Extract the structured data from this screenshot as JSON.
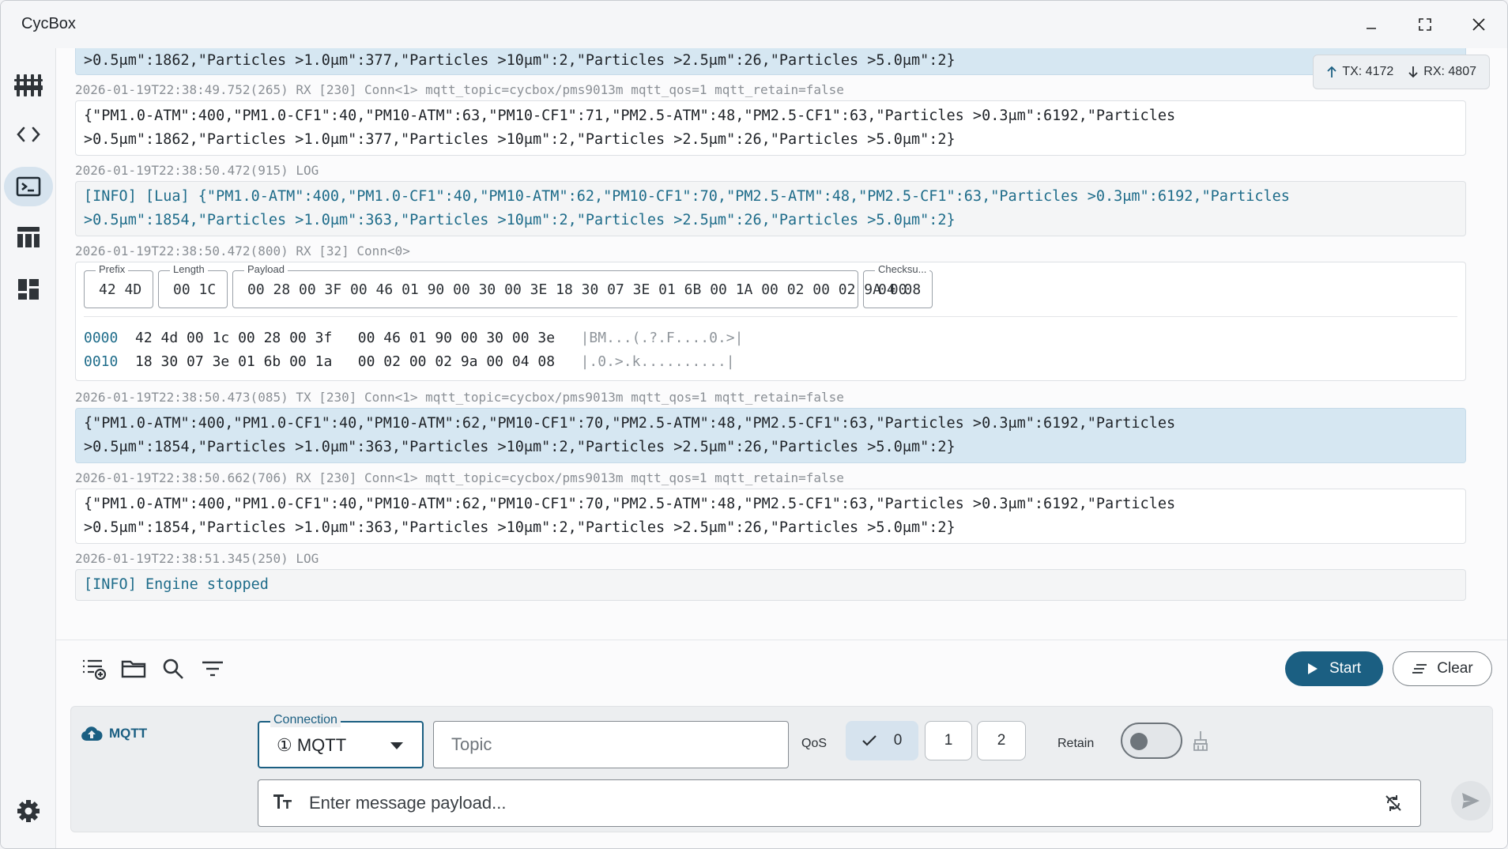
{
  "window": {
    "title": "CycBox"
  },
  "sidebar": {
    "items": [
      {
        "icon": "sliders-icon"
      },
      {
        "icon": "code-icon"
      },
      {
        "icon": "terminal-icon",
        "active": true
      },
      {
        "icon": "table-icon"
      },
      {
        "icon": "dashboard-icon"
      }
    ],
    "settings_icon": "gear-icon"
  },
  "stats": {
    "tx": "TX: 4172",
    "rx": "RX: 4807"
  },
  "log": {
    "top_partial": ">0.5μm\":1862,\"Particles >1.0μm\":377,\"Particles >10μm\":2,\"Particles >2.5μm\":26,\"Particles >5.0μm\":2}",
    "entry1": {
      "meta": "2026-01-19T22:38:49.752(265) RX [230] Conn<1> mqtt_topic=cycbox/pms9013m mqtt_qos=1 mqtt_retain=false",
      "line1": "{\"PM1.0-ATM\":400,\"PM1.0-CF1\":40,\"PM10-ATM\":63,\"PM10-CF1\":71,\"PM2.5-ATM\":48,\"PM2.5-CF1\":63,\"Particles >0.3μm\":6192,\"Particles",
      "line2": ">0.5μm\":1862,\"Particles >1.0μm\":377,\"Particles >10μm\":2,\"Particles >2.5μm\":26,\"Particles >5.0μm\":2}"
    },
    "entry2": {
      "meta": "2026-01-19T22:38:50.472(915) LOG",
      "line1": "[INFO] [Lua] {\"PM1.0-ATM\":400,\"PM1.0-CF1\":40,\"PM10-ATM\":62,\"PM10-CF1\":70,\"PM2.5-ATM\":48,\"PM2.5-CF1\":63,\"Particles >0.3μm\":6192,\"Particles",
      "line2": ">0.5μm\":1854,\"Particles >1.0μm\":363,\"Particles >10μm\":2,\"Particles >2.5μm\":26,\"Particles >5.0μm\":2}"
    },
    "entry3": {
      "meta": "2026-01-19T22:38:50.472(800) RX [32] Conn<0>",
      "fields": {
        "prefix_label": "Prefix",
        "prefix_value": "42 4D",
        "length_label": "Length",
        "length_value": "00 1C",
        "payload_label": "Payload",
        "payload_value": "00 28 00 3F 00 46 01 90 00 30 00 3E 18 30 07 3E 01 6B 00 1A 00 02 00 02 9A 00",
        "checksum_label": "Checksu...",
        "checksum_value": "04 08"
      },
      "hexdump": [
        {
          "offset": "0000",
          "bytes": "  42 4d 00 1c 00 28 00 3f   00 46 01 90 00 30 00 3e   ",
          "ascii": "|BM...(.?.F....0.>|"
        },
        {
          "offset": "0010",
          "bytes": "  18 30 07 3e 01 6b 00 1a   00 02 00 02 9a 00 04 08   ",
          "ascii": "|.0.>.k..........|"
        }
      ]
    },
    "entry4": {
      "meta": "2026-01-19T22:38:50.473(085) TX [230] Conn<1> mqtt_topic=cycbox/pms9013m mqtt_qos=1 mqtt_retain=false",
      "line1": "{\"PM1.0-ATM\":400,\"PM1.0-CF1\":40,\"PM10-ATM\":62,\"PM10-CF1\":70,\"PM2.5-ATM\":48,\"PM2.5-CF1\":63,\"Particles >0.3μm\":6192,\"Particles",
      "line2": ">0.5μm\":1854,\"Particles >1.0μm\":363,\"Particles >10μm\":2,\"Particles >2.5μm\":26,\"Particles >5.0μm\":2}"
    },
    "entry5": {
      "meta": "2026-01-19T22:38:50.662(706) RX [230] Conn<1> mqtt_topic=cycbox/pms9013m mqtt_qos=1 mqtt_retain=false",
      "line1": "{\"PM1.0-ATM\":400,\"PM1.0-CF1\":40,\"PM10-ATM\":62,\"PM10-CF1\":70,\"PM2.5-ATM\":48,\"PM2.5-CF1\":63,\"Particles >0.3μm\":6192,\"Particles",
      "line2": ">0.5μm\":1854,\"Particles >1.0μm\":363,\"Particles >10μm\":2,\"Particles >2.5μm\":26,\"Particles >5.0μm\":2}"
    },
    "entry6": {
      "meta": "2026-01-19T22:38:51.345(250) LOG",
      "line1": "[INFO] Engine stopped"
    }
  },
  "toolbar": {
    "start_label": "Start",
    "clear_label": "Clear"
  },
  "compose": {
    "protocol_label": "MQTT",
    "connection_label": "Connection",
    "connection_value": "① MQTT",
    "topic_placeholder": "Topic",
    "qos_label": "QoS",
    "qos_options": [
      "0",
      "1",
      "2"
    ],
    "qos_selected": "0",
    "retain_label": "Retain",
    "retain_on": false,
    "payload_placeholder": "Enter message payload..."
  },
  "colors": {
    "accent": "#1b5f82",
    "tx_bg": "#d6e7f2",
    "log_text": "#1e6c8a"
  }
}
